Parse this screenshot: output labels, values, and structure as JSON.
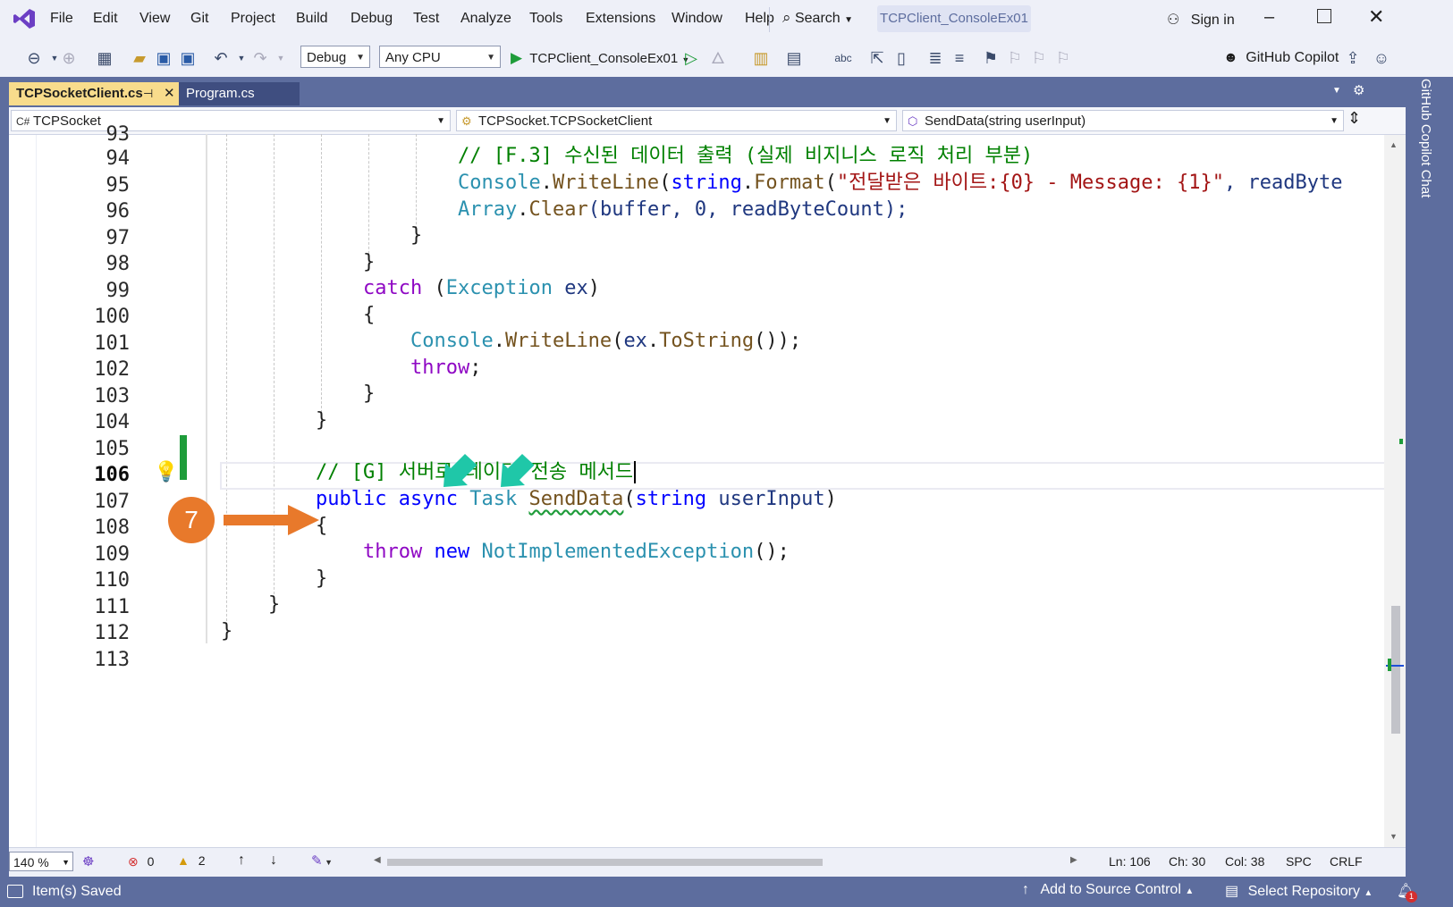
{
  "app": {
    "menu": [
      "File",
      "Edit",
      "View",
      "Git",
      "Project",
      "Build",
      "Debug",
      "Test",
      "Analyze",
      "Tools",
      "Extensions",
      "Window",
      "Help"
    ],
    "search_label": "Search",
    "solution_name": "TCPClient_ConsoleEx01",
    "sign_in": "Sign in"
  },
  "toolbar": {
    "config": "Debug",
    "platform": "Any CPU",
    "start_target": "TCPClient_ConsoleEx01",
    "copilot": "GitHub Copilot"
  },
  "tabs": [
    {
      "label": "TCPSocketClient.cs",
      "active": true
    },
    {
      "label": "Program.cs",
      "active": false
    }
  ],
  "navbar": {
    "project": "TCPSocket",
    "type": "TCPSocket.TCPSocketClient",
    "member": "SendData(string userInput)"
  },
  "side_panel_label": "GitHub Copilot Chat",
  "code": {
    "line_numbers": [
      "93",
      "94",
      "95",
      "96",
      "97",
      "98",
      "99",
      "100",
      "101",
      "102",
      "103",
      "104",
      "105",
      "106",
      "107",
      "108",
      "109",
      "110",
      "111",
      "112",
      "113"
    ],
    "active_line": "106",
    "l94": "// [F.3] 수신된 데이터 출력 (실제 비지니스 로직 처리 부분)",
    "l95_console": "Console",
    "l95_dot1": ".",
    "l95_writeline": "WriteLine",
    "l95_paren": "(",
    "l95_string": "string",
    "l95_dot2": ".",
    "l95_format": "Format",
    "l95_paren2": "(",
    "l95_literal": "\"전달받은 바이트:{0} - Message: {1}\"",
    "l95_rest": ", readByte",
    "l96_array": "Array",
    "l96_dot": ".",
    "l96_clear": "Clear",
    "l96_args": "(buffer, 0, readByteCount);",
    "brace_close": "}",
    "brace_open": "{",
    "l99_catch": "catch",
    "l99_open": " (",
    "l99_exception": "Exception",
    "l99_ex": " ex",
    "l99_close": ")",
    "l101_console": "Console",
    "l101_dot": ".",
    "l101_writeline": "WriteLine",
    "l101_open": "(",
    "l101_ex": "ex",
    "l101_dot2": ".",
    "l101_tostring": "ToString",
    "l101_close": "());",
    "l102_throw": "throw",
    "l102_semi": ";",
    "l106_comment": "// [G] 서버로 데이터 전송 메서드",
    "l107_public": "public",
    "l107_async": "async",
    "l107_task": "Task",
    "l107_method": "SendData",
    "l107_open": "(",
    "l107_string": "string",
    "l107_param": "userInput",
    "l107_close": ")",
    "l109_throw": "throw",
    "l109_new": "new",
    "l109_exc": "NotImplementedException",
    "l109_end": "();"
  },
  "annotation": {
    "step_number": "7",
    "marker_color": "#e8792b",
    "arrow_color": "#1fc7a8"
  },
  "status": {
    "zoom": "140 %",
    "errors": "0",
    "warnings": "2",
    "ln": "Ln: 106",
    "ch": "Ch: 30",
    "col": "Col: 38",
    "spc": "SPC",
    "crlf": "CRLF",
    "message": "Item(s) Saved",
    "source_control": "Add to Source Control",
    "repository": "Select Repository",
    "notifications": "1"
  }
}
